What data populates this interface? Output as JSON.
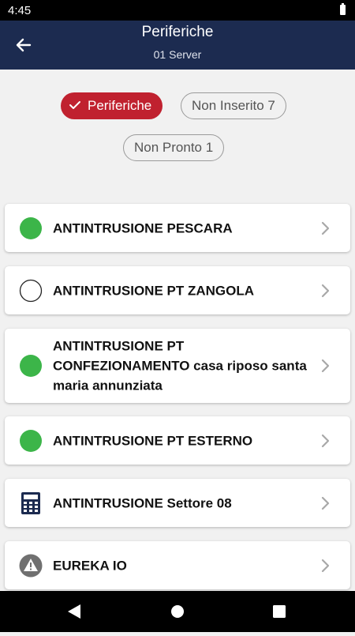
{
  "status_bar": {
    "time": "4:45"
  },
  "header": {
    "title": "Periferiche",
    "subtitle": "01 Server"
  },
  "filters": {
    "active": "Periferiche",
    "not_inserted": "Non Inserito 7",
    "not_ready": "Non Pronto 1"
  },
  "colors": {
    "header_bg": "#1c2b50",
    "active_chip": "#c0212f",
    "status_green": "#3cb549"
  },
  "devices": [
    {
      "label": "ANTINTRUSIONE PESCARA",
      "icon": "status-green-icon"
    },
    {
      "label": "ANTINTRUSIONE PT ZANGOLA",
      "icon": "status-empty-icon"
    },
    {
      "label": "ANTINTRUSIONE PT CONFEZIONAMENTO casa riposo santa maria annunziata",
      "icon": "status-green-icon"
    },
    {
      "label": "ANTINTRUSIONE PT ESTERNO",
      "icon": "status-green-icon"
    },
    {
      "label": "ANTINTRUSIONE Settore 08",
      "icon": "keypad-icon"
    },
    {
      "label": "EUREKA IO",
      "icon": "warning-icon"
    }
  ]
}
